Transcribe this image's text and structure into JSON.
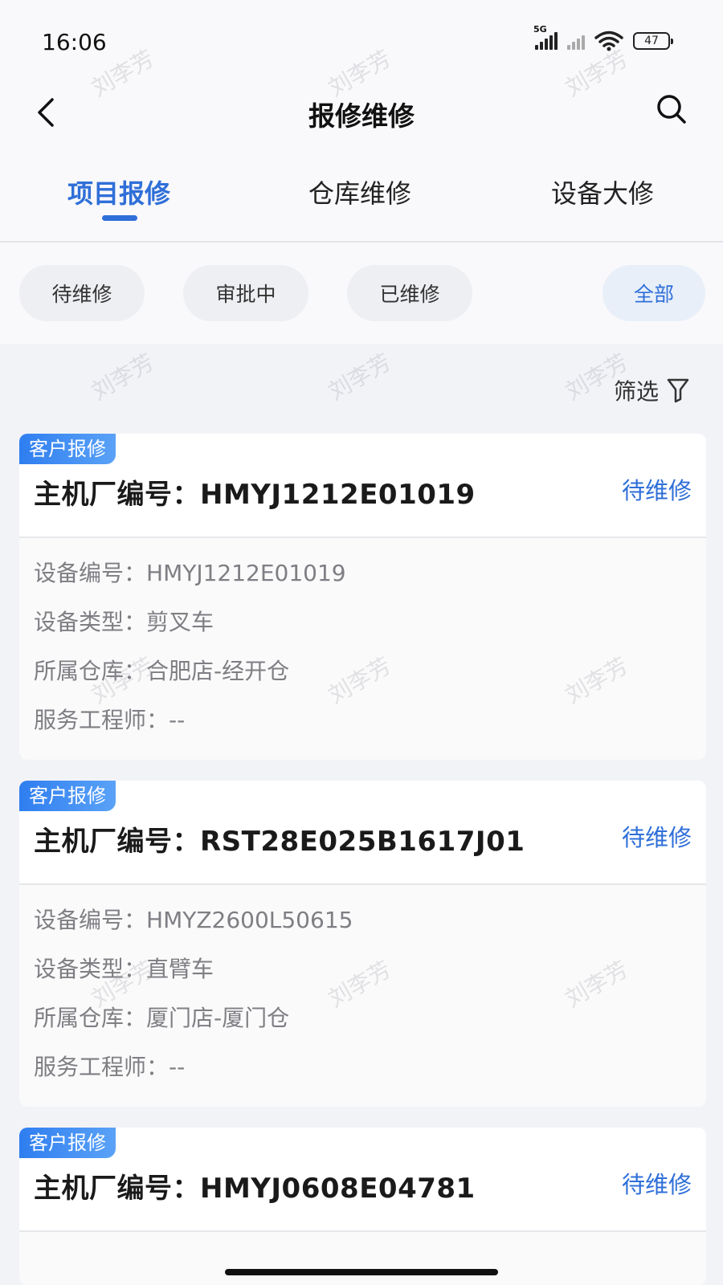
{
  "status_bar": {
    "time": "16:06",
    "network": "5G",
    "battery": "47"
  },
  "header": {
    "title": "报修维修"
  },
  "tabs": [
    {
      "label": "项目报修",
      "active": true
    },
    {
      "label": "仓库维修",
      "active": false
    },
    {
      "label": "设备大修",
      "active": false
    }
  ],
  "chips": [
    {
      "label": "待维修",
      "selected": false
    },
    {
      "label": "审批中",
      "selected": false
    },
    {
      "label": "已维修",
      "selected": false
    },
    {
      "label": "全部",
      "selected": true
    }
  ],
  "filter_label": "筛选",
  "watermark": "刘李芳",
  "cards": [
    {
      "badge": "客户报修",
      "title": "主机厂编号：HMYJ1212E01019",
      "status": "待维修",
      "rows": [
        {
          "label": "设备编号：",
          "value": "HMYJ1212E01019"
        },
        {
          "label": "设备类型：",
          "value": "剪叉车"
        },
        {
          "label": "所属仓库：",
          "value": "合肥店-经开仓"
        },
        {
          "label": "服务工程师：",
          "value": "--"
        }
      ]
    },
    {
      "badge": "客户报修",
      "title": "主机厂编号：RST28E025B1617J01",
      "status": "待维修",
      "rows": [
        {
          "label": "设备编号：",
          "value": "HMYZ2600L50615"
        },
        {
          "label": "设备类型：",
          "value": "直臂车"
        },
        {
          "label": "所属仓库：",
          "value": "厦门店-厦门仓"
        },
        {
          "label": "服务工程师：",
          "value": "--"
        }
      ]
    },
    {
      "badge": "客户报修",
      "title": "主机厂编号：HMYJ0608E04781",
      "status": "待维修",
      "rows": []
    }
  ],
  "colors": {
    "accent": "#2f6fd8",
    "background": "#f2f3f7",
    "badge": "#2f7ef0"
  }
}
